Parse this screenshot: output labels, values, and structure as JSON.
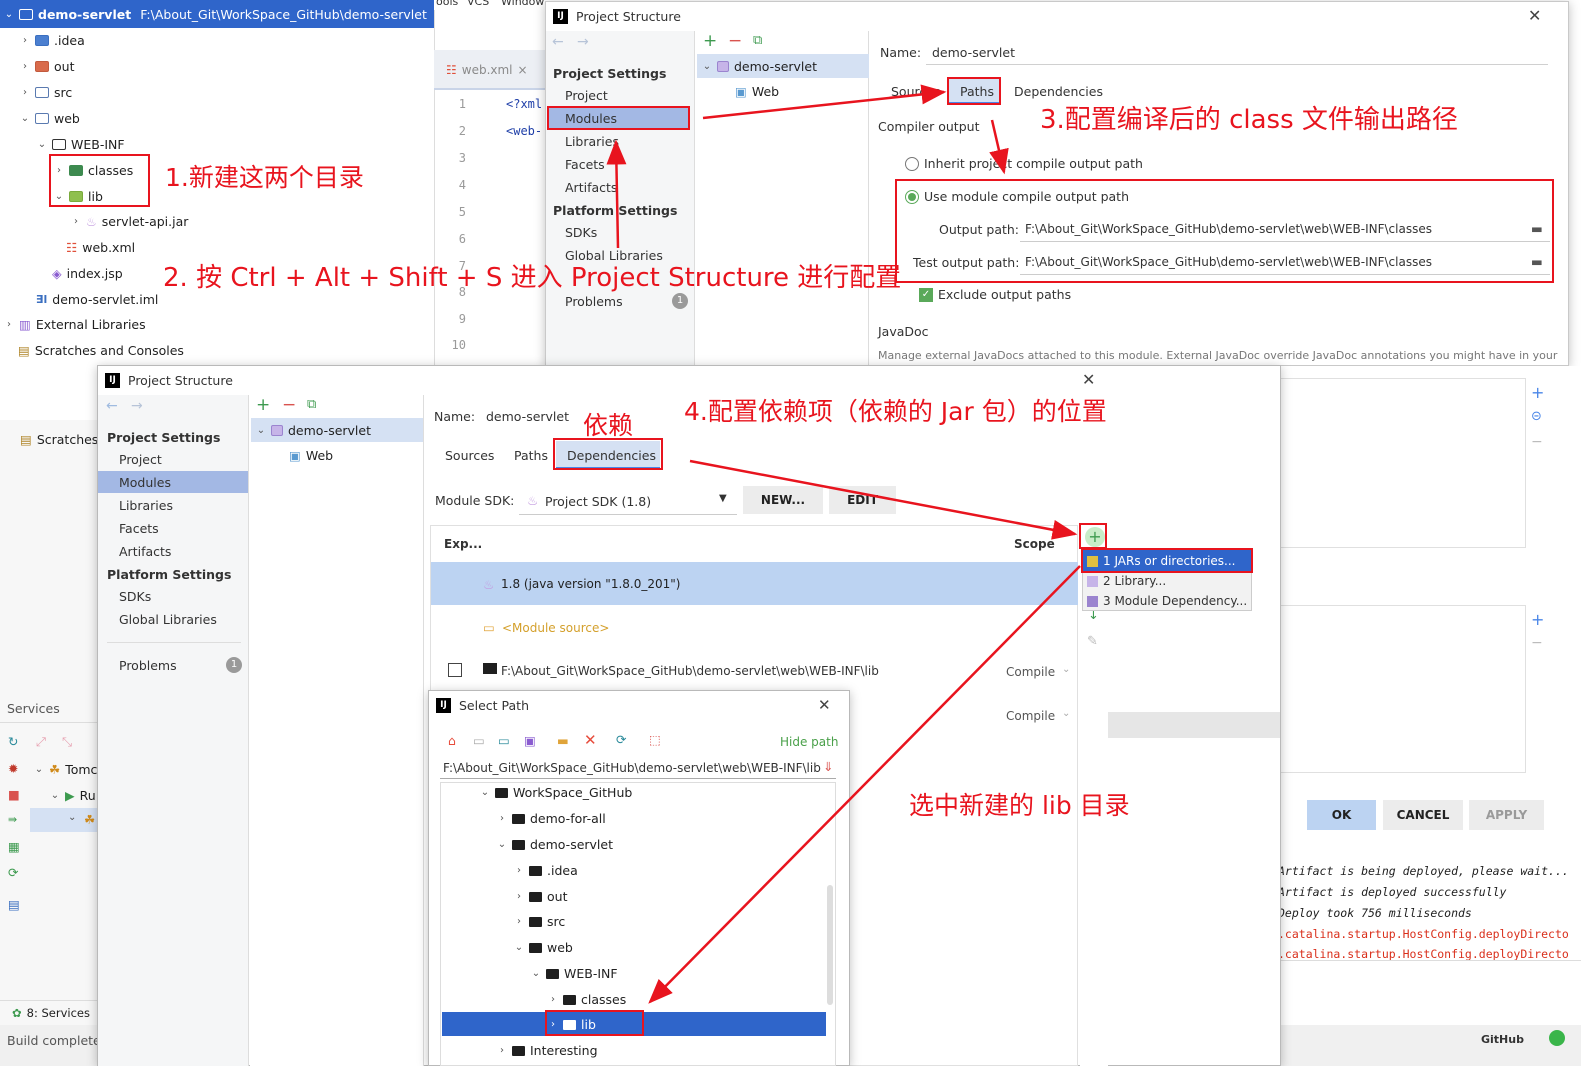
{
  "project_tree": {
    "root_label": "demo-servlet",
    "root_path": "F:\\About_Git\\WorkSpace_GitHub\\demo-servlet",
    "items": [
      ".idea",
      "out",
      "src",
      "web",
      "WEB-INF",
      "classes",
      "lib",
      "servlet-api.jar",
      "web.xml",
      "index.jsp",
      "demo-servlet.iml",
      "External Libraries",
      "Scratches and Consoles"
    ]
  },
  "menubar": {
    "tools": "ools",
    "vcs": "VCS",
    "window": "Window"
  },
  "editor": {
    "tab": "web.xml",
    "lines": [
      "1",
      "2",
      "3",
      "4",
      "5",
      "6",
      "7",
      "8",
      "9",
      "10"
    ],
    "code1": "<?xml",
    "code2": "<web-"
  },
  "dialog1": {
    "title": "Project Structure",
    "nav": {
      "project_settings": "Project Settings",
      "project": "Project",
      "modules": "Modules",
      "libraries": "Libraries",
      "facets": "Facets",
      "artifacts": "Artifacts",
      "platform_settings": "Platform Settings",
      "sdks": "SDKs",
      "global_libraries": "Global Libraries",
      "problems": "Problems",
      "problems_count": "1"
    },
    "module": "demo-servlet",
    "web": "Web",
    "name_label": "Name:",
    "name_value": "demo-servlet",
    "tabs": {
      "sources": "Sources",
      "paths": "Paths",
      "dependencies": "Dependencies"
    },
    "compiler_output": "Compiler output",
    "inherit": "Inherit project compile output path",
    "use_module": "Use module compile output path",
    "output_label": "Output path:",
    "output_value": "F:\\About_Git\\WorkSpace_GitHub\\demo-servlet\\web\\WEB-INF\\classes",
    "test_label": "Test output path:",
    "test_value": "F:\\About_Git\\WorkSpace_GitHub\\demo-servlet\\web\\WEB-INF\\classes",
    "exclude": "Exclude output paths",
    "javadoc": "JavaDoc",
    "javadoc_desc": "Manage external JavaDocs attached to this module. External JavaDoc override JavaDoc annotations you might have in your"
  },
  "dialog2": {
    "title": "Project Structure",
    "nav": {
      "project_settings": "Project Settings",
      "project": "Project",
      "modules": "Modules",
      "libraries": "Libraries",
      "facets": "Facets",
      "artifacts": "Artifacts",
      "platform_settings": "Platform Settings",
      "sdks": "SDKs",
      "global_libraries": "Global Libraries",
      "problems": "Problems",
      "problems_count": "1"
    },
    "module": "demo-servlet",
    "web": "Web",
    "name_label": "Name:",
    "name_value": "demo-servlet",
    "tabs": {
      "sources": "Sources",
      "paths": "Paths",
      "dependencies": "Dependencies"
    },
    "sdk_label": "Module SDK:",
    "sdk_value": "Project SDK (1.8)",
    "new_btn": "NEW...",
    "edit_btn": "EDIT",
    "col_exp": "Exp...",
    "col_scope": "Scope",
    "dep_jdk": "1.8 (java version \"1.8.0_201\")",
    "dep_source": "<Module source>",
    "dep_lib": "F:\\About_Git\\WorkSpace_GitHub\\demo-servlet\\web\\WEB-INF\\lib",
    "scope1": "Compile",
    "scope2": "Compile",
    "popup": [
      "1  JARs or directories...",
      "2  Library...",
      "3  Module Dependency..."
    ],
    "ok": "OK",
    "cancel": "CANCEL",
    "apply": "APPLY"
  },
  "select_path": {
    "title": "Select Path",
    "hide_path": "Hide path",
    "path": "F:\\About_Git\\WorkSpace_GitHub\\demo-servlet\\web\\WEB-INF\\lib",
    "tree": [
      "WorkSpace_GitHub",
      "demo-for-all",
      "demo-servlet",
      ".idea",
      "out",
      "src",
      "web",
      "WEB-INF",
      "classes",
      "lib",
      "Interesting"
    ]
  },
  "services": {
    "header": "Services",
    "tomcat": "Tomca",
    "run": "Ru",
    "tab": "8: Services",
    "build": "Build completed",
    "scratches": "Scratches"
  },
  "log": [
    "Artifact is being deployed, please wait...",
    "Artifact is deployed successfully",
    "Deploy took 756 milliseconds",
    ".catalina.startup.HostConfig.deployDirecto",
    ".catalina.startup.HostConfig.deployDirecto"
  ],
  "github": "GitHub",
  "annotations": {
    "a1": "1.新建这两个目录",
    "a2": "2. 按 Ctrl + Alt + Shift + S 进入 Project Structure 进行配置",
    "a3": "3.配置编译后的 class 文件输出路径",
    "a4": "4.配置依赖项（依赖的 Jar 包）的位置",
    "a5": "依赖",
    "a6": "选中新建的 lib 目录"
  },
  "colors": {
    "annotation": "#e8141e",
    "selection": "#a3b8e4",
    "tree_selection": "#2f65ca"
  }
}
